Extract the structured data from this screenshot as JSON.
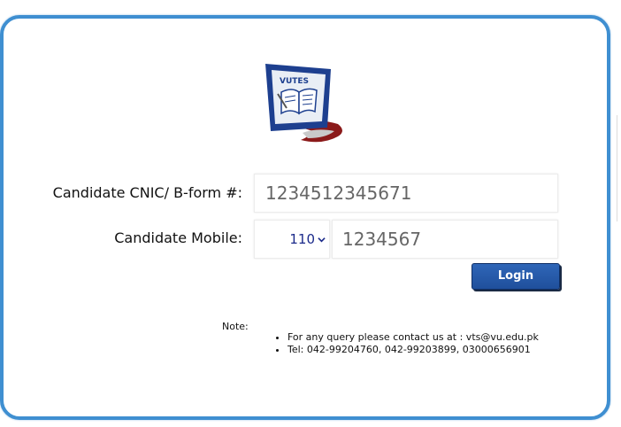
{
  "logo": {
    "text": "VUTES",
    "colors": {
      "frame": "#1d3f8f",
      "screen": "#e9eef5",
      "accent": "#8b1a1a"
    }
  },
  "form": {
    "cnic_label": "Candidate CNIC/ B-form #:",
    "cnic_value": "1234512345671",
    "mobile_label": "Candidate Mobile:",
    "mobile_code": "110",
    "mobile_value": "1234567",
    "login_label": "Login"
  },
  "note": {
    "title": "Note:",
    "items": [
      "For any query please contact us at : vts@vu.edu.pk",
      "Tel: 042-99204760, 042-99203899, 03000656901"
    ]
  },
  "colors": {
    "frame_border": "#3f8fd1",
    "button": "#1f4f9c"
  }
}
